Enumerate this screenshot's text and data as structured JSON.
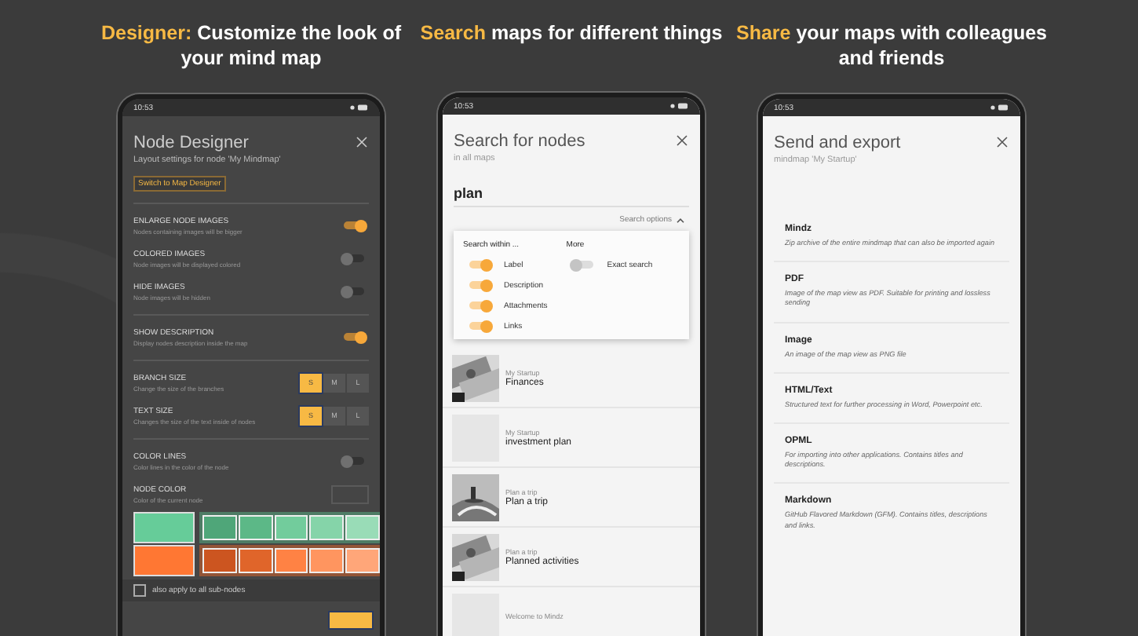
{
  "headlines": [
    {
      "accent": "Designer:",
      "text": "Customize the look of your mind map"
    },
    {
      "accent": "Search",
      "text": "maps for different things"
    },
    {
      "accent": "Share",
      "text": "your maps with colleagues and friends"
    }
  ],
  "designer": {
    "time": "10:53",
    "title": "Node Designer",
    "subtitle": "Layout settings for node 'My Mindmap'",
    "switch_button": "Switch to Map Designer",
    "groups": [
      [
        {
          "kind": "toggle",
          "label": "ENLARGE NODE IMAGES",
          "description": "Nodes containing images will be bigger",
          "on": true
        },
        {
          "kind": "toggle",
          "label": "COLORED IMAGES",
          "description": "Node images will be displayed colored",
          "on": false
        },
        {
          "kind": "toggle",
          "label": "HIDE IMAGES",
          "description": "Node images will be hidden",
          "on": false
        }
      ],
      [
        {
          "kind": "toggle",
          "label": "SHOW DESCRIPTION",
          "description": "Display nodes description inside the map",
          "on": true
        }
      ],
      [
        {
          "kind": "size",
          "label": "BRANCH SIZE",
          "description": "Change the size of the branches",
          "options": [
            {
              "label": "S",
              "selected": true
            },
            {
              "label": "M",
              "selected": false
            },
            {
              "label": "L",
              "selected": false
            }
          ]
        },
        {
          "kind": "size",
          "label": "TEXT SIZE",
          "description": "Changes the size of the text inside of nodes",
          "options": [
            {
              "label": "S",
              "selected": true
            },
            {
              "label": "M",
              "selected": false
            },
            {
              "label": "L",
              "selected": false
            }
          ]
        }
      ],
      [
        {
          "kind": "toggle",
          "label": "COLOR LINES",
          "description": "Color lines in the color of the node",
          "on": false
        },
        {
          "kind": "color",
          "label": "NODE COLOR",
          "description": "Color of the current node"
        }
      ]
    ],
    "palette": [
      {
        "color": "#66cc99",
        "shades": [
          {
            "color": "#4fa679"
          },
          {
            "color": "#5cb887"
          },
          {
            "color": "#72cc9c"
          },
          {
            "color": "#85d4a9"
          },
          {
            "color": "#99dcb7"
          }
        ]
      },
      {
        "color": "#ff7733",
        "shades": [
          {
            "color": "#cc5520"
          },
          {
            "color": "#e0652a"
          },
          {
            "color": "#ff8244"
          },
          {
            "color": "#ff955f"
          },
          {
            "color": "#ffa679"
          }
        ]
      }
    ],
    "apply_all": {
      "label": "also apply to all sub-nodes",
      "checked": false
    }
  },
  "search": {
    "time": "10:53",
    "title": "Search for nodes",
    "subtitle": "in all maps",
    "query": "plan",
    "options_label": "Search options",
    "within_label": "Search within ...",
    "within": [
      {
        "label": "Label",
        "on": true
      },
      {
        "label": "Description",
        "on": true
      },
      {
        "label": "Attachments",
        "on": true
      },
      {
        "label": "Links",
        "on": true
      }
    ],
    "more_label": "More",
    "more": [
      {
        "label": "Exact search",
        "on": false
      }
    ],
    "results": [
      {
        "map": "My Startup",
        "title": "Finances",
        "kind": "picture"
      },
      {
        "map": "My Startup",
        "title": "investment plan",
        "kind": "empty"
      },
      {
        "map": "Plan a trip",
        "title": "Plan a trip",
        "kind": "picture"
      },
      {
        "map": "Plan a trip",
        "title": "Planned activities",
        "kind": "picture"
      },
      {
        "map": "Welcome to Mindz",
        "kind": "empty"
      }
    ]
  },
  "export": {
    "time": "10:53",
    "title": "Send and export",
    "subtitle": "mindmap 'My Startup'",
    "formats": [
      {
        "name": "Mindz",
        "description": "Zip archive of the entire mindmap that can also be imported again"
      },
      {
        "name": "PDF",
        "description": "Image of the map view as PDF. Suitable for printing and lossless sending"
      },
      {
        "name": "Image",
        "description": "An image of the map view as PNG file"
      },
      {
        "name": "HTML/Text",
        "description": "Structured text for further processing in Word, Powerpoint etc."
      },
      {
        "name": "OPML",
        "description": "For importing into other applications. Contains titles and descriptions."
      },
      {
        "name": "Markdown",
        "description": "GitHub Flavored Markdown (GFM). Contains titles, descriptions and links."
      }
    ]
  }
}
